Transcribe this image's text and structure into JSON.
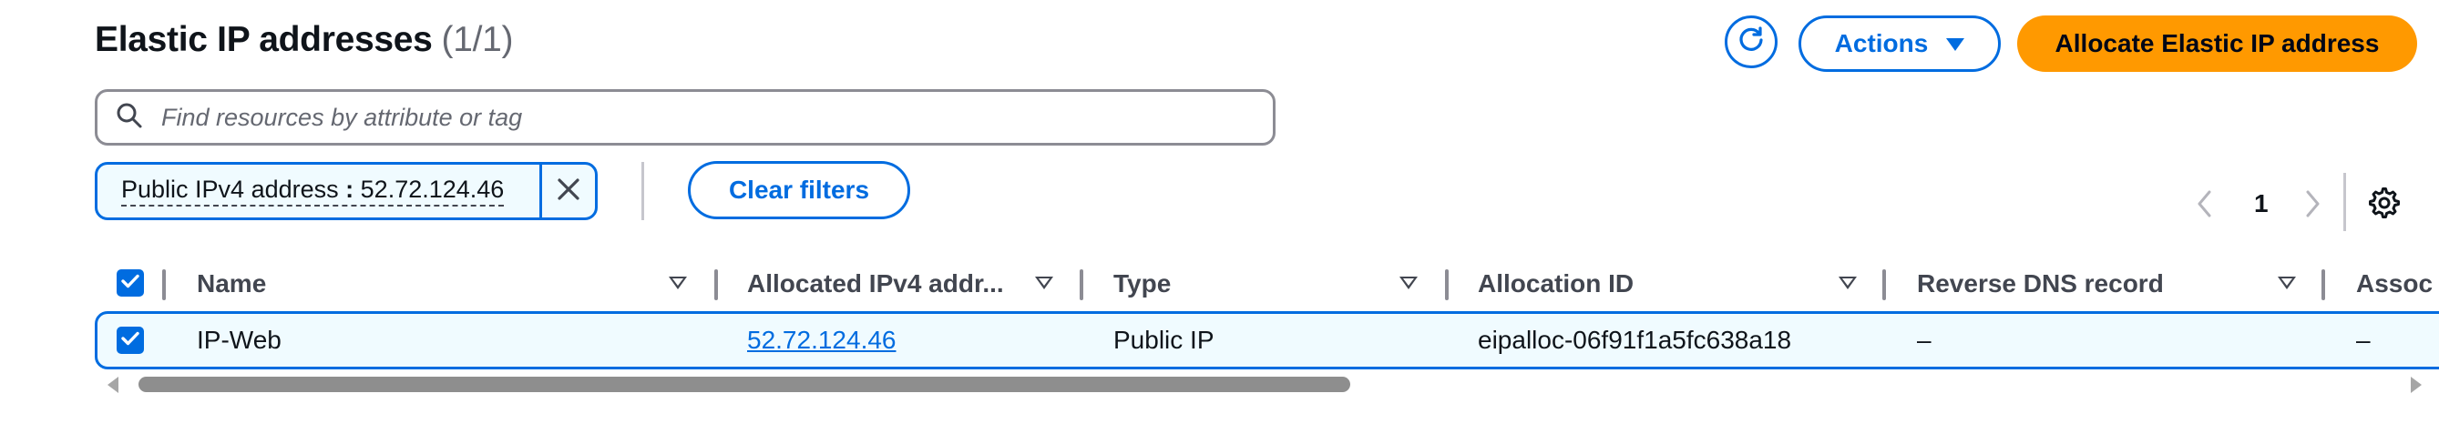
{
  "header": {
    "title": "Elastic IP addresses",
    "count": "(1/1)",
    "actions_label": "Actions",
    "allocate_label": "Allocate Elastic IP address"
  },
  "search": {
    "placeholder": "Find resources by attribute or tag",
    "value": ""
  },
  "filter_token": {
    "key": "Public IPv4 address",
    "operator": ":",
    "value": "52.72.124.46"
  },
  "clear_filters_label": "Clear filters",
  "pagination": {
    "current_page": "1"
  },
  "table": {
    "columns": [
      "Name",
      "Allocated IPv4 addr...",
      "Type",
      "Allocation ID",
      "Reverse DNS record",
      "Assoc"
    ],
    "rows": [
      {
        "selected": true,
        "name": "IP-Web",
        "ipv4": "52.72.124.46",
        "type": "Public IP",
        "allocation_id": "eipalloc-06f91f1a5fc638a18",
        "reverse_dns": "–",
        "assoc": "–"
      }
    ]
  },
  "icons": {
    "refresh": "refresh-icon",
    "actions_caret": "caret-down-icon",
    "search": "search-icon",
    "token_close": "close-icon",
    "prev": "chevron-left-icon",
    "next": "chevron-right-icon",
    "settings": "gear-icon",
    "checkbox": "checkmark-icon"
  },
  "colors": {
    "accent": "#006ce0",
    "primary_button": "#ff9900",
    "selected_row_bg": "#f0fbff",
    "text": "#0f141a",
    "muted_text": "#656871"
  }
}
